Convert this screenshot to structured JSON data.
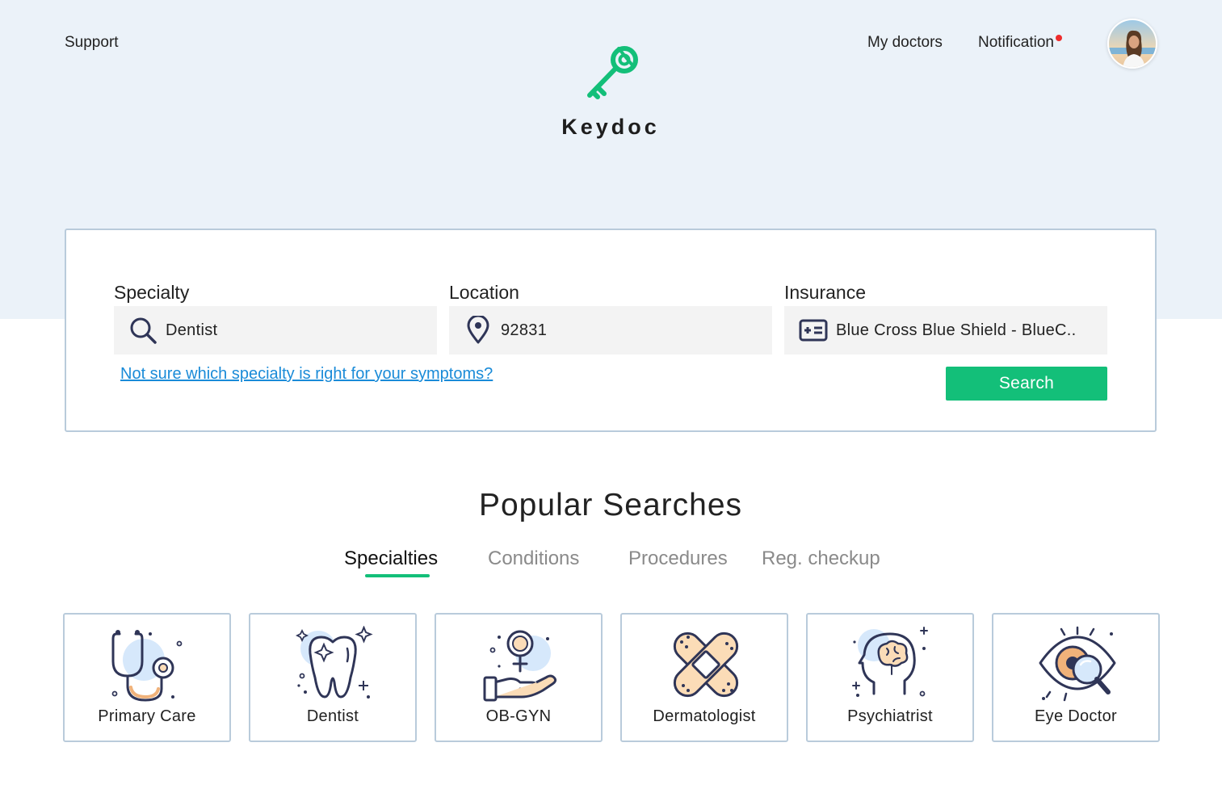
{
  "header": {
    "support": "Support",
    "my_doctors": "My doctors",
    "notification": "Notification",
    "brand": "Keydoc"
  },
  "search": {
    "specialty_label": "Specialty",
    "specialty_value": "Dentist",
    "location_label": "Location",
    "location_value": "92831",
    "insurance_label": "Insurance",
    "insurance_value": "Blue Cross Blue Shield - BlueC..",
    "help_link": "Not sure which specialty is right for your symptoms?",
    "button": "Search"
  },
  "popular": {
    "title": "Popular Searches",
    "tabs": [
      "Specialties",
      "Conditions",
      "Procedures",
      "Reg. checkup"
    ],
    "active_tab": "Specialties",
    "cards": [
      {
        "label": "Primary Care",
        "icon": "stethoscope-icon"
      },
      {
        "label": "Dentist",
        "icon": "tooth-icon"
      },
      {
        "label": "OB-GYN",
        "icon": "female-symbol-hand-icon"
      },
      {
        "label": "Dermatologist",
        "icon": "bandage-icon"
      },
      {
        "label": "Psychiatrist",
        "icon": "brain-head-icon"
      },
      {
        "label": "Eye Doctor",
        "icon": "eye-magnifier-icon"
      }
    ]
  },
  "colors": {
    "accent": "#13bf79",
    "hero_bg": "#ebf2f9",
    "link": "#1a8bd8",
    "notification_dot": "#ee2c2c",
    "icon_blue_tint": "#d6e8fb",
    "icon_peach_tint": "#fbdcb7",
    "icon_stroke": "#2f3557"
  }
}
